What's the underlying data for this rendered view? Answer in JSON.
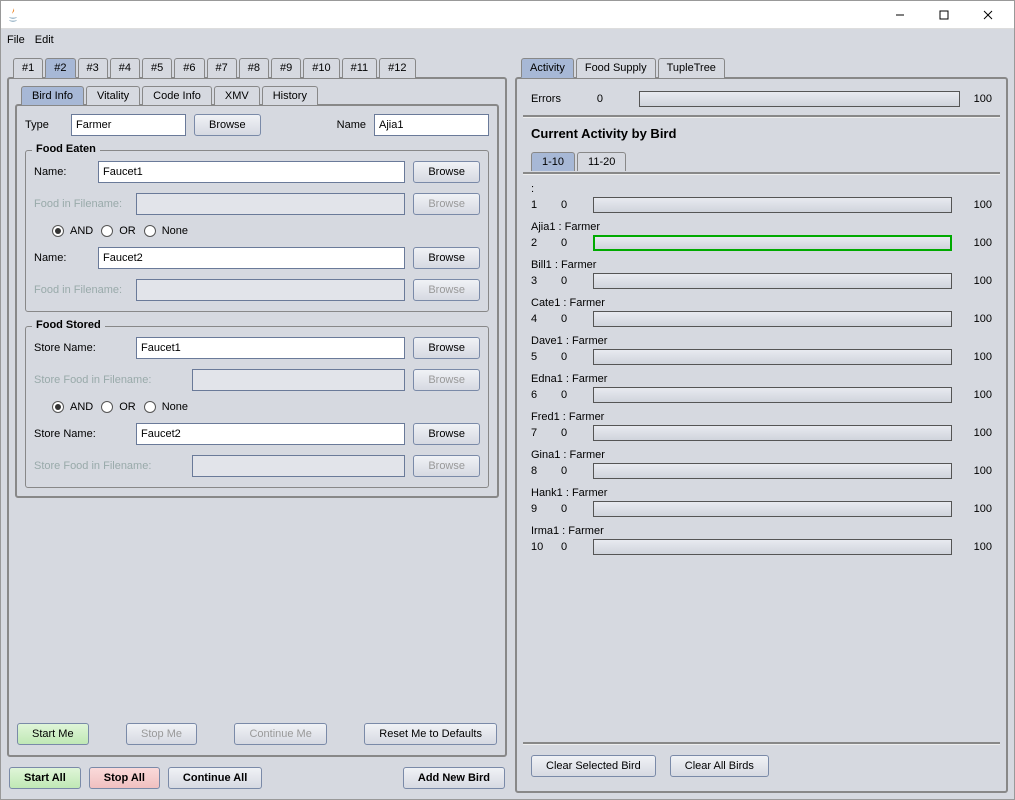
{
  "window": {
    "minimize": "–",
    "maximize": "☐",
    "close": "✕"
  },
  "menu": {
    "file": "File",
    "edit": "Edit"
  },
  "numtabs": [
    "#1",
    "#2",
    "#3",
    "#4",
    "#5",
    "#6",
    "#7",
    "#8",
    "#9",
    "#10",
    "#11",
    "#12"
  ],
  "numtab_active": 1,
  "subtabs": [
    "Bird Info",
    "Vitality",
    "Code Info",
    "XMV",
    "History"
  ],
  "subtab_active": 0,
  "form": {
    "type_label": "Type",
    "type_value": "Farmer",
    "browse": "Browse",
    "name_label": "Name",
    "name_value": "Ajia1",
    "food_eaten_title": "Food Eaten",
    "fe_name": "Name:",
    "fe_name1": "Faucet1",
    "fe_name2": "Faucet2",
    "fe_file": "Food in Filename:",
    "and": "AND",
    "or": "OR",
    "none": "None",
    "food_stored_title": "Food Stored",
    "fs_name": "Store Name:",
    "fs_name1": "Faucet1",
    "fs_name2": "Faucet2",
    "fs_file": "Store Food in Filename:"
  },
  "btns": {
    "start_me": "Start Me",
    "stop_me": "Stop Me",
    "continue_me": "Continue Me",
    "reset": "Reset Me to Defaults",
    "start_all": "Start All",
    "stop_all": "Stop All",
    "continue_all": "Continue All",
    "add_bird": "Add New Bird",
    "clear_sel": "Clear Selected Bird",
    "clear_all": "Clear All Birds"
  },
  "right": {
    "tabs": [
      "Activity",
      "Food Supply",
      "TupleTree"
    ],
    "tab_active": 0,
    "errors_label": "Errors",
    "errors_val": "0",
    "errors_max": "100",
    "heading": "Current Activity by Bird",
    "page_tabs": [
      "1-10",
      "11-20"
    ],
    "page_active": 0,
    "birds": [
      {
        "label": ":",
        "idx": "1",
        "val": "0",
        "max": "100"
      },
      {
        "label": "Ajia1 : Farmer",
        "idx": "2",
        "val": "0",
        "max": "100",
        "green": true
      },
      {
        "label": "Bill1 : Farmer",
        "idx": "3",
        "val": "0",
        "max": "100"
      },
      {
        "label": "Cate1 : Farmer",
        "idx": "4",
        "val": "0",
        "max": "100"
      },
      {
        "label": "Dave1 : Farmer",
        "idx": "5",
        "val": "0",
        "max": "100"
      },
      {
        "label": "Edna1 : Farmer",
        "idx": "6",
        "val": "0",
        "max": "100"
      },
      {
        "label": "Fred1 : Farmer",
        "idx": "7",
        "val": "0",
        "max": "100"
      },
      {
        "label": "Gina1 : Farmer",
        "idx": "8",
        "val": "0",
        "max": "100"
      },
      {
        "label": "Hank1 : Farmer",
        "idx": "9",
        "val": "0",
        "max": "100"
      },
      {
        "label": "Irma1 : Farmer",
        "idx": "10",
        "val": "0",
        "max": "100"
      }
    ]
  }
}
